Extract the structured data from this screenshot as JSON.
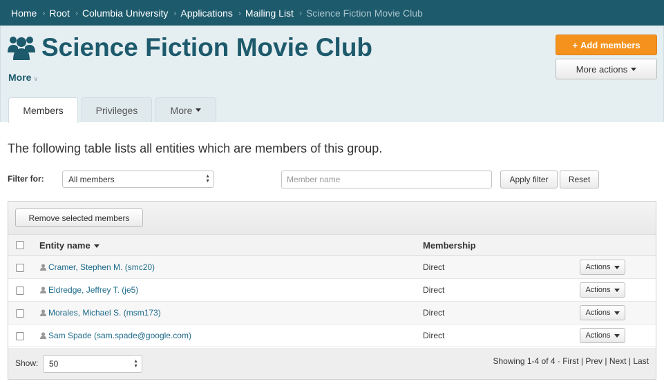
{
  "breadcrumb": {
    "items": [
      "Home",
      "Root",
      "Columbia University",
      "Applications",
      "Mailing List"
    ],
    "current": "Science Fiction Movie Club",
    "separator": "›"
  },
  "header": {
    "title": "Science Fiction Movie Club",
    "more_label": "More",
    "add_members_label": "Add members",
    "more_actions_label": "More actions"
  },
  "tabs": [
    {
      "label": "Members",
      "active": true
    },
    {
      "label": "Privileges",
      "active": false
    },
    {
      "label": "More",
      "active": false
    }
  ],
  "intro": "The following table lists all entities which are members of this group.",
  "filter": {
    "label": "Filter for:",
    "select_value": "All members",
    "name_placeholder": "Member name",
    "apply_label": "Apply filter",
    "reset_label": "Reset"
  },
  "table": {
    "remove_label": "Remove selected members",
    "columns": {
      "entity": "Entity name",
      "membership": "Membership"
    },
    "rows": [
      {
        "entity": "Cramer, Stephen M. (smc20)",
        "membership": "Direct",
        "action": "Actions"
      },
      {
        "entity": "Eldredge, Jeffrey T. (je5)",
        "membership": "Direct",
        "action": "Actions"
      },
      {
        "entity": "Morales, Michael S. (msm173)",
        "membership": "Direct",
        "action": "Actions"
      },
      {
        "entity": "Sam Spade (sam.spade@google.com)",
        "membership": "Direct",
        "action": "Actions"
      }
    ]
  },
  "footer": {
    "show_label": "Show:",
    "page_size": "50",
    "showing": "Showing 1-4 of 4",
    "first": "First",
    "prev": "Prev",
    "next": "Next",
    "last": "Last"
  },
  "colors": {
    "brand": "#1d5a6c",
    "accent": "#f5921e",
    "header_bg": "#e5eef1",
    "link": "#1d6a8a"
  },
  "icons": {
    "group": "group-icon",
    "person": "person-icon",
    "plus": "plus-icon"
  }
}
